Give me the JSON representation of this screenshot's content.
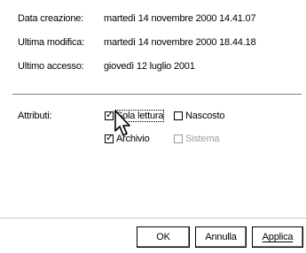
{
  "properties": [
    {
      "label": "Data creazione:",
      "value": "martedì 14 novembre 2000 14.41.07"
    },
    {
      "label": "Ultima modifica:",
      "value": "martedì 14 novembre 2000 18.44.18"
    },
    {
      "label": "Ultimo accesso:",
      "value": "giovedì 12 luglio 2001"
    }
  ],
  "attributes": {
    "label": "Attributi:",
    "readonly": {
      "label": "Sola lettura",
      "checked": true
    },
    "hidden": {
      "label": "Nascosto",
      "checked": false
    },
    "archive": {
      "label": "Archivio",
      "checked": true
    },
    "system": {
      "label": "Sistema",
      "checked": false,
      "enabled": false
    }
  },
  "buttons": {
    "ok": "OK",
    "cancel": "Annulla",
    "apply": "Applica"
  }
}
